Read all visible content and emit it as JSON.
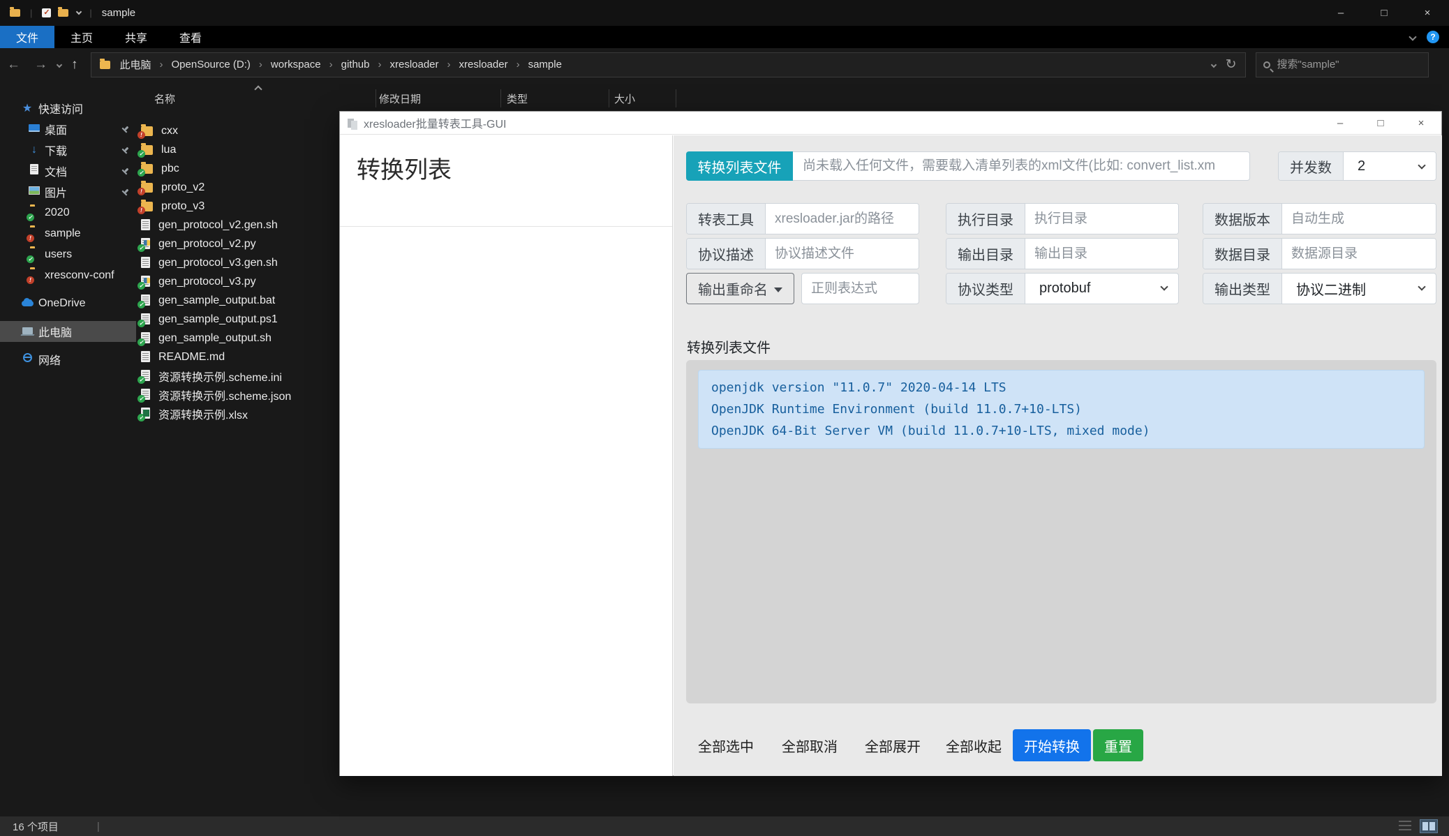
{
  "window_controls": {
    "minimize": "–",
    "maximize": "□",
    "close": "×"
  },
  "colors": {
    "ribbon_accent": "#1a6fc4",
    "teal_button": "#17a2b8",
    "start_button_blue": "#1273eb",
    "reset_button_green": "#28a745",
    "log_bg": "#cfe3f7",
    "log_text": "#175f9d"
  },
  "explorer": {
    "window_title": "sample",
    "ribbon": {
      "tabs": [
        {
          "label": "文件"
        },
        {
          "label": "主页"
        },
        {
          "label": "共享"
        },
        {
          "label": "查看"
        }
      ],
      "help": "?"
    },
    "nav": {
      "back": "←",
      "forward": "→",
      "up": "↑",
      "refresh": "↻"
    },
    "breadcrumb": {
      "separator": "›",
      "items": [
        "此电脑",
        "OpenSource (D:)",
        "workspace",
        "github",
        "xresloader",
        "xresloader",
        "sample"
      ]
    },
    "search": {
      "placeholder": "搜索\"sample\""
    },
    "sidebar": {
      "quick_access": "快速访问",
      "quick_items": [
        {
          "label": "桌面"
        },
        {
          "label": "下载"
        },
        {
          "label": "文档"
        },
        {
          "label": "图片"
        },
        {
          "label": "2020"
        },
        {
          "label": "sample"
        },
        {
          "label": "users"
        },
        {
          "label": "xresconv-conf"
        }
      ],
      "sections": [
        {
          "label": "OneDrive"
        },
        {
          "label": "此电脑"
        },
        {
          "label": "网络"
        }
      ]
    },
    "list": {
      "columns": [
        "名称",
        "修改日期",
        "类型",
        "大小"
      ],
      "files": [
        {
          "name": "cxx"
        },
        {
          "name": "lua"
        },
        {
          "name": "pbc"
        },
        {
          "name": "proto_v2"
        },
        {
          "name": "proto_v3"
        },
        {
          "name": "gen_protocol_v2.gen.sh"
        },
        {
          "name": "gen_protocol_v2.py"
        },
        {
          "name": "gen_protocol_v3.gen.sh"
        },
        {
          "name": "gen_protocol_v3.py"
        },
        {
          "name": "gen_sample_output.bat"
        },
        {
          "name": "gen_sample_output.ps1"
        },
        {
          "name": "gen_sample_output.sh"
        },
        {
          "name": "README.md"
        },
        {
          "name": "资源转换示例.scheme.ini"
        },
        {
          "name": "资源转换示例.scheme.json"
        },
        {
          "name": "资源转换示例.xlsx"
        }
      ]
    },
    "statusbar": {
      "count": "16 个项目",
      "divider": "|"
    }
  },
  "gui": {
    "window_title": "xresloader批量转表工具-GUI",
    "left_panel": {
      "heading": "转换列表"
    },
    "toolbar": {
      "load_button": "转换列表文件",
      "list_placeholder": "尚未载入任何文件，需要载入清单列表的xml文件(比如: convert_list.xm",
      "concurrency_label": "并发数",
      "concurrency_value": "2"
    },
    "form": {
      "col1": [
        {
          "label": "转表工具",
          "placeholder": "xresloader.jar的路径"
        },
        {
          "label": "协议描述",
          "placeholder": "协议描述文件"
        },
        {
          "label": "输出重命名",
          "placeholder": "正则表达式"
        }
      ],
      "col2": [
        {
          "label": "执行目录",
          "placeholder": "执行目录"
        },
        {
          "label": "输出目录",
          "placeholder": "输出目录"
        },
        {
          "label": "协议类型",
          "value": "protobuf"
        }
      ],
      "col3": [
        {
          "label": "数据版本",
          "placeholder": "自动生成"
        },
        {
          "label": "数据目录",
          "placeholder": "数据源目录"
        },
        {
          "label": "输出类型",
          "value": "协议二进制"
        }
      ]
    },
    "section_label": "转换列表文件",
    "log": {
      "lines": [
        "openjdk version \"11.0.7\" 2020-04-14 LTS",
        "OpenJDK Runtime Environment (build 11.0.7+10-LTS)",
        "OpenJDK 64-Bit Server VM (build 11.0.7+10-LTS, mixed mode)"
      ]
    },
    "actions": {
      "select_all": "全部选中",
      "deselect_all": "全部取消",
      "expand_all": "全部展开",
      "collapse_all": "全部收起",
      "start": "开始转换",
      "reset": "重置"
    }
  }
}
